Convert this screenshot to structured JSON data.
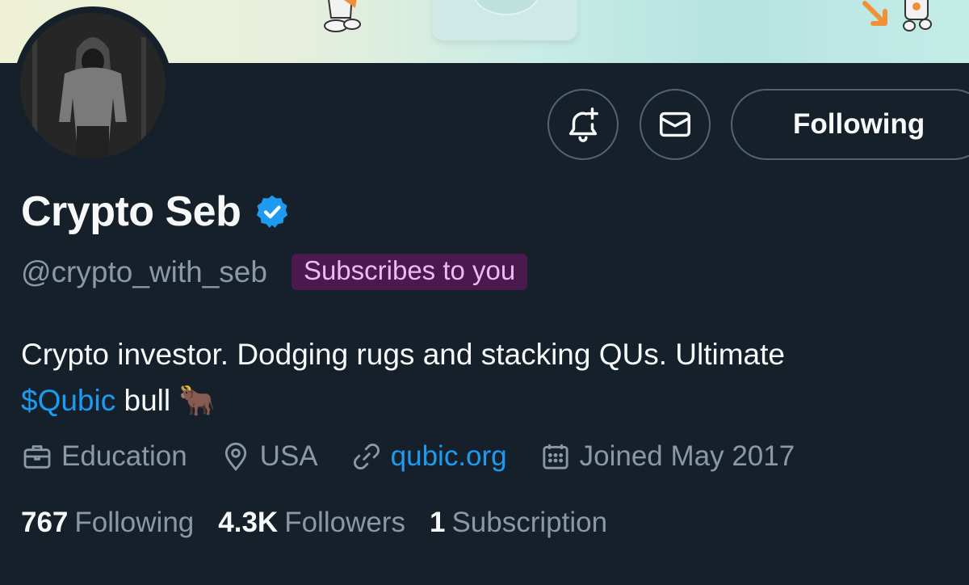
{
  "profile": {
    "name": "Crypto Seb",
    "handle": "@crypto_with_seb",
    "subscribes_badge": "Subscribes to you",
    "bio": {
      "text_before": "Crypto investor. Dodging rugs and stacking QUs. Ultimate",
      "cashtag": "$Qubic",
      "text_after": "bull",
      "emoji": "🐂"
    },
    "meta": {
      "category": "Education",
      "location": "USA",
      "website": "qubic.org",
      "joined": "Joined May 2017"
    },
    "stats": {
      "following_count": "767",
      "following_label": "Following",
      "followers_count": "4.3K",
      "followers_label": "Followers",
      "subscription_count": "1",
      "subscription_label": "Subscription"
    }
  },
  "actions": {
    "following_label": "Following",
    "notify_icon": "bell-plus-icon",
    "message_icon": "envelope-icon"
  },
  "colors": {
    "background": "#15202b",
    "accent": "#1d9bf0",
    "secondary_text": "#8b98a5",
    "badge_bg": "#4a1a4e",
    "badge_text": "#f1b8f4"
  }
}
